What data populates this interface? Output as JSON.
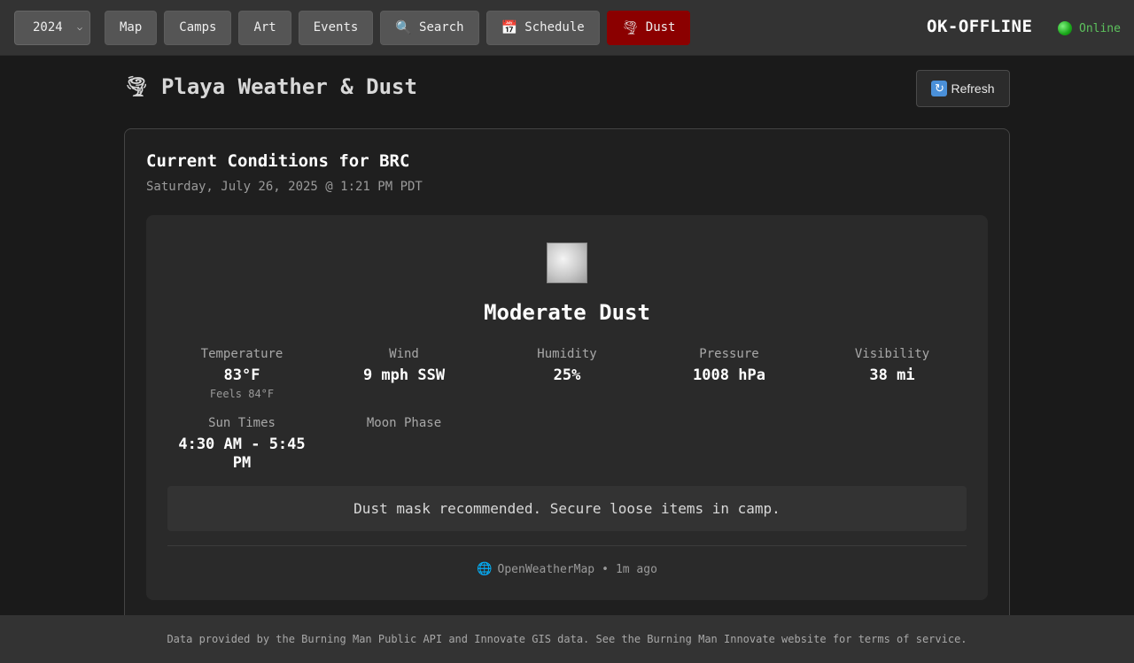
{
  "nav": {
    "year": "2024",
    "items": [
      {
        "label": "Map"
      },
      {
        "label": "Camps"
      },
      {
        "label": "Art"
      },
      {
        "label": "Events"
      },
      {
        "label": "Search",
        "icon": "magnifier-icon"
      },
      {
        "label": "Schedule",
        "icon": "calendar-icon"
      },
      {
        "label": "Dust",
        "icon": "tornado-icon",
        "active": true
      }
    ],
    "brand": "OK-OFFLINE",
    "status": "Online"
  },
  "page": {
    "title": "Playa Weather & Dust",
    "refresh_label": "Refresh"
  },
  "weather": {
    "heading": "Current Conditions for BRC",
    "timestamp": "Saturday, July 26, 2025 @ 1:21 PM PDT",
    "condition": "Moderate Dust",
    "stats": {
      "temperature": {
        "label": "Temperature",
        "value": "83°F",
        "feels": "Feels 84°F"
      },
      "wind": {
        "label": "Wind",
        "value": "9 mph SSW"
      },
      "humidity": {
        "label": "Humidity",
        "value": "25%"
      },
      "pressure": {
        "label": "Pressure",
        "value": "1008 hPa"
      },
      "visibility": {
        "label": "Visibility",
        "value": "38 mi"
      },
      "sun": {
        "label": "Sun Times",
        "value": "4:30 AM - 5:45 PM"
      },
      "moon": {
        "label": "Moon Phase",
        "value": ""
      }
    },
    "advice": "Dust mask recommended. Secure loose items in camp.",
    "source": "OpenWeatherMap",
    "updated": "1m ago"
  },
  "footer": {
    "text": "Data provided by the Burning Man Public API and Innovate GIS data. See the Burning Man Innovate website for terms of service."
  },
  "colors": {
    "accent_active": "#8b0000",
    "status_online": "#5dc25d"
  }
}
